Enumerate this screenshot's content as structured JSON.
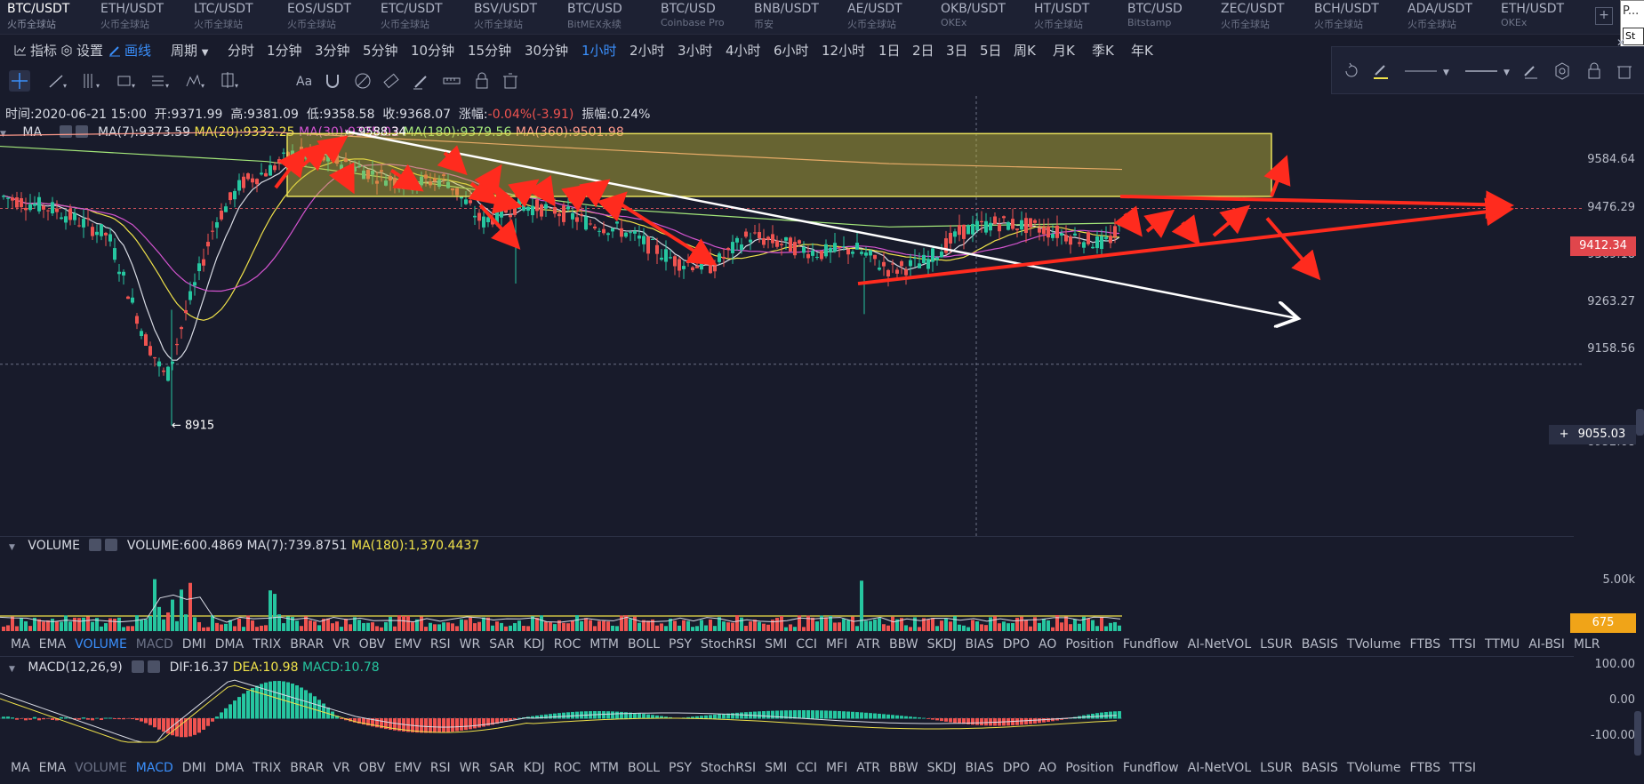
{
  "tabs": [
    {
      "symbol": "BTC/USDT",
      "exchange": "火币全球站",
      "active": true
    },
    {
      "symbol": "ETH/USDT",
      "exchange": "火币全球站"
    },
    {
      "symbol": "LTC/USDT",
      "exchange": "火币全球站"
    },
    {
      "symbol": "EOS/USDT",
      "exchange": "火币全球站"
    },
    {
      "symbol": "ETC/USDT",
      "exchange": "火币全球站"
    },
    {
      "symbol": "BSV/USDT",
      "exchange": "火币全球站"
    },
    {
      "symbol": "BTC/USD",
      "exchange": "BitMEX永续"
    },
    {
      "symbol": "BTC/USD",
      "exchange": "Coinbase Pro"
    },
    {
      "symbol": "BNB/USDT",
      "exchange": "币安"
    },
    {
      "symbol": "AE/USDT",
      "exchange": "火币全球站"
    },
    {
      "symbol": "OKB/USDT",
      "exchange": "OKEx"
    },
    {
      "symbol": "HT/USDT",
      "exchange": "火币全球站"
    },
    {
      "symbol": "BTC/USD",
      "exchange": "Bitstamp"
    },
    {
      "symbol": "ZEC/USDT",
      "exchange": "火币全球站"
    },
    {
      "symbol": "BCH/USDT",
      "exchange": "火币全球站"
    },
    {
      "symbol": "ADA/USDT",
      "exchange": "火币全球站"
    },
    {
      "symbol": "ETH/USDT",
      "exchange": "OKEx"
    }
  ],
  "popup": {
    "text1": "P...",
    "text2": "St"
  },
  "toolbar": {
    "indicators_label": "指标",
    "settings_label": "设置",
    "draw_label": "画线",
    "period_label": "周期",
    "periods": [
      "分时",
      "1分钟",
      "3分钟",
      "5分钟",
      "10分钟",
      "15分钟",
      "30分钟",
      "1小时",
      "2小时",
      "3小时",
      "4小时",
      "6小时",
      "12小时",
      "1日",
      "2日",
      "3日",
      "5日",
      "周K",
      "月K",
      "季K",
      "年K"
    ],
    "active_period": "1小时"
  },
  "ohlc": {
    "time_label": "时间:",
    "time": "2020-06-21 15:00",
    "open_label": "开:",
    "open": "9371.99",
    "high_label": "高:",
    "high": "9381.09",
    "low_label": "低:",
    "low": "9358.58",
    "close_label": "收:",
    "close": "9368.07",
    "change_label": "涨幅:",
    "change": "-0.04%(-3.91)",
    "amplitude_label": "振幅:",
    "amplitude": "0.24%"
  },
  "ma_legend": {
    "name": "MA",
    "ma7": "MA(7):9373.59",
    "ma20": "MA(20):9332.25",
    "ma30": "MA(30):9325.02",
    "ma180": "MA(180):9379.56",
    "ma360": "MA(360):9501.98",
    "colors": {
      "ma7": "#d8dbe4",
      "ma20": "#f0e24a",
      "ma30": "#d454d0",
      "ma180": "#a4e87a",
      "ma360": "#ff9a8a"
    }
  },
  "price_axis": [
    "9584.64",
    "9476.29",
    "9369.18",
    "9263.27",
    "9158.56",
    "8952.68"
  ],
  "current_price": "9412.34",
  "crosshair_price": "9055.03",
  "annotations": {
    "high_mark": "9588.34",
    "low_mark": "8915"
  },
  "volume": {
    "name": "VOLUME",
    "value": "VOLUME:600.4869",
    "ma7": "MA(7):739.8751",
    "ma180": "MA(180):1,370.4437",
    "axis_label": "5.00k",
    "current": "675"
  },
  "indicator_bar_1": [
    "MA",
    "EMA",
    "VOLUME",
    "MACD",
    "DMI",
    "DMA",
    "TRIX",
    "BRAR",
    "VR",
    "OBV",
    "EMV",
    "RSI",
    "WR",
    "SAR",
    "KDJ",
    "ROC",
    "MTM",
    "BOLL",
    "PSY",
    "StochRSI",
    "SMI",
    "CCI",
    "MFI",
    "ATR",
    "BBW",
    "SKDJ",
    "BIAS",
    "DPO",
    "AO",
    "Position",
    "Fundflow",
    "AI-NetVOL",
    "LSUR",
    "BASIS",
    "TVolume",
    "FTBS",
    "TTSI",
    "TTMU",
    "AI-BSI",
    "MLR"
  ],
  "indicator_bar_1_active": "VOLUME",
  "indicator_bar_1_dim": "MACD",
  "macd": {
    "name": "MACD(12,26,9)",
    "dif": "DIF:16.37",
    "dea": "DEA:10.98",
    "macd": "MACD:10.78",
    "axis": [
      "100.00",
      "0.00",
      "-100.00"
    ]
  },
  "indicator_bar_2": [
    "MA",
    "EMA",
    "VOLUME",
    "MACD",
    "DMI",
    "DMA",
    "TRIX",
    "BRAR",
    "VR",
    "OBV",
    "EMV",
    "RSI",
    "WR",
    "SAR",
    "KDJ",
    "ROC",
    "MTM",
    "BOLL",
    "PSY",
    "StochRSI",
    "SMI",
    "CCI",
    "MFI",
    "ATR",
    "BBW",
    "SKDJ",
    "BIAS",
    "DPO",
    "AO",
    "Position",
    "Fundflow",
    "AI-NetVOL",
    "LSUR",
    "BASIS",
    "TVolume",
    "FTBS",
    "TTSI"
  ],
  "indicator_bar_2_active": "MACD",
  "indicator_bar_2_dim": "VOLUME"
}
